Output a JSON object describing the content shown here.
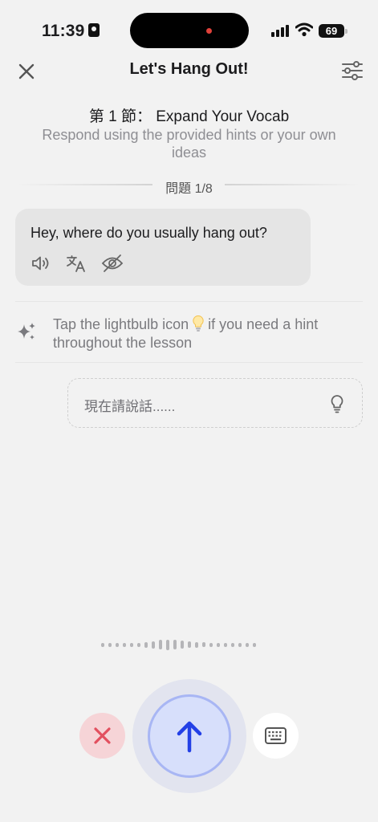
{
  "status_bar": {
    "time": "11:39",
    "battery": "69"
  },
  "header": {
    "title": "Let's Hang Out!"
  },
  "lesson": {
    "heading": "第 1 節： Expand Your Vocab",
    "subtitle": "Respond using the provided hints or your own ideas",
    "question_counter": "問題 1/8"
  },
  "prompt": {
    "message": "Hey, where do you usually hang out?"
  },
  "hint": {
    "text_before": "Tap the lightbulb icon",
    "text_after": "if you need a hint throughout the lesson"
  },
  "answer_input": {
    "placeholder": "現在請說話......"
  },
  "colors": {
    "background": "#f2f2f2",
    "send_accent": "#2340e6",
    "cancel_accent": "#e2505f",
    "bubble": "#e5e5e5"
  },
  "icons": {
    "close": "close-icon",
    "settings": "sliders-icon",
    "speaker": "speaker-icon",
    "translate": "translate-icon",
    "hide": "eye-slash-icon",
    "sparkle": "sparkle-icon",
    "lightbulb": "lightbulb-icon",
    "send": "arrow-up-icon",
    "cancel": "x-icon",
    "keyboard": "keyboard-icon"
  }
}
